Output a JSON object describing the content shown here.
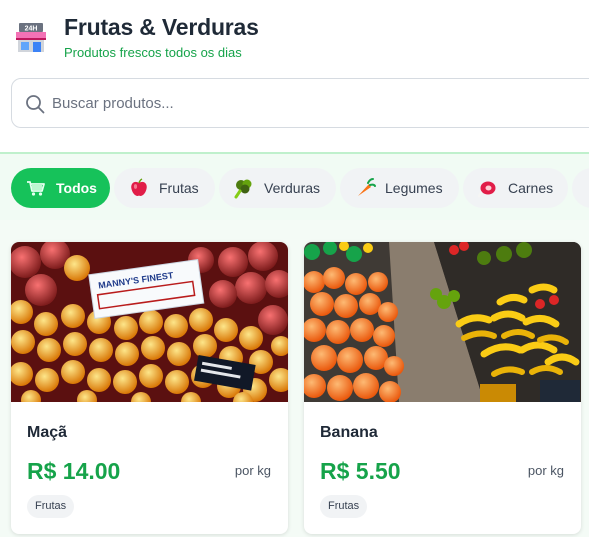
{
  "header": {
    "title": "Frutas & Verduras",
    "subtitle": "Produtos frescos todos os dias",
    "store_icon_text": "24H"
  },
  "search": {
    "placeholder": "Buscar produtos...",
    "value": ""
  },
  "categories": [
    {
      "label": "Todos",
      "icon": "cart-icon",
      "active": true
    },
    {
      "label": "Frutas",
      "icon": "apple-icon",
      "active": false
    },
    {
      "label": "Verduras",
      "icon": "broccoli-icon",
      "active": false
    },
    {
      "label": "Legumes",
      "icon": "carrot-icon",
      "active": false
    },
    {
      "label": "Carnes",
      "icon": "meat-icon",
      "active": false
    },
    {
      "label": "",
      "icon": "",
      "active": false
    }
  ],
  "products": [
    {
      "name": "Maçã",
      "price": "R$ 14.00",
      "unit": "por kg",
      "category": "Frutas",
      "image": "apples-photo",
      "sign_text": "MANNY'S FINEST"
    },
    {
      "name": "Banana",
      "price": "R$ 5.50",
      "unit": "por kg",
      "category": "Frutas",
      "image": "fruit-market-photo"
    }
  ],
  "colors": {
    "accent": "#16c25a",
    "price": "#16a34a",
    "subtitle": "#16a34a",
    "band": "#f1fbf4"
  }
}
